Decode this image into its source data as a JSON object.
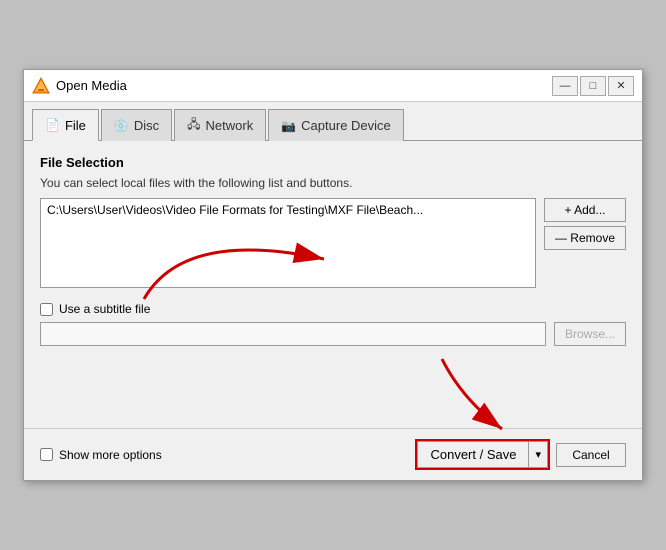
{
  "window": {
    "title": "Open Media",
    "controls": {
      "minimize": "—",
      "restore": "□",
      "close": "✕"
    }
  },
  "tabs": [
    {
      "id": "file",
      "label": "File",
      "icon": "📄",
      "active": true
    },
    {
      "id": "disc",
      "label": "Disc",
      "icon": "💿",
      "active": false
    },
    {
      "id": "network",
      "label": "Network",
      "icon": "🖧",
      "active": false
    },
    {
      "id": "capture",
      "label": "Capture Device",
      "icon": "📷",
      "active": false
    }
  ],
  "file_tab": {
    "section_label": "File Selection",
    "description": "You can select local files with the following list and buttons.",
    "file_path": "C:\\Users\\User\\Videos\\Video File Formats for Testing\\MXF File\\Beach...",
    "add_button": "+ Add...",
    "remove_button": "— Remove",
    "subtitle_checkbox_label": "Use a subtitle file",
    "subtitle_checked": false,
    "browse_button": "Browse..."
  },
  "bottom": {
    "show_more_label": "Show more options",
    "show_more_checked": false,
    "convert_save_label": "Convert / Save",
    "cancel_label": "Cancel"
  }
}
